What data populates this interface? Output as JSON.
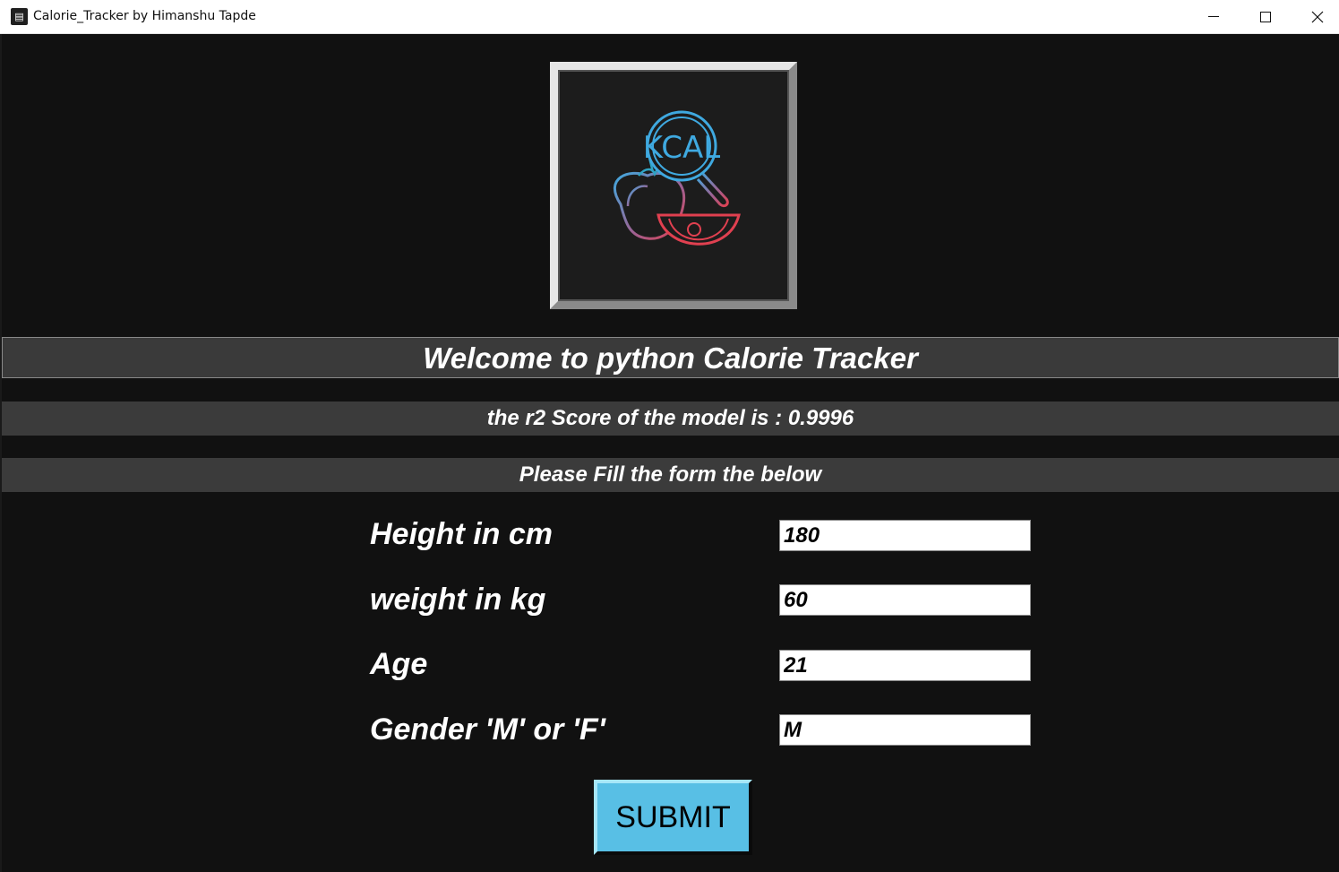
{
  "window": {
    "title": "Calorie_Tracker by Himanshu Tapde"
  },
  "logo": {
    "text": "KCAL",
    "icon": "kcal-tomato-logo",
    "colors": [
      "#3fa9e0",
      "#e04050",
      "#a06090"
    ]
  },
  "banners": {
    "welcome": "Welcome to python Calorie Tracker",
    "score": "the r2 Score of the model is : 0.9996",
    "fill": "Please Fill the form the below"
  },
  "form": {
    "height": {
      "label": "Height in cm",
      "value": "180"
    },
    "weight": {
      "label": "weight in kg",
      "value": "60"
    },
    "age": {
      "label": "Age",
      "value": "21"
    },
    "gender": {
      "label": "Gender 'M' or 'F'",
      "value": "M"
    }
  },
  "submit": {
    "label": "SUBMIT",
    "color": "#58bfe5"
  }
}
